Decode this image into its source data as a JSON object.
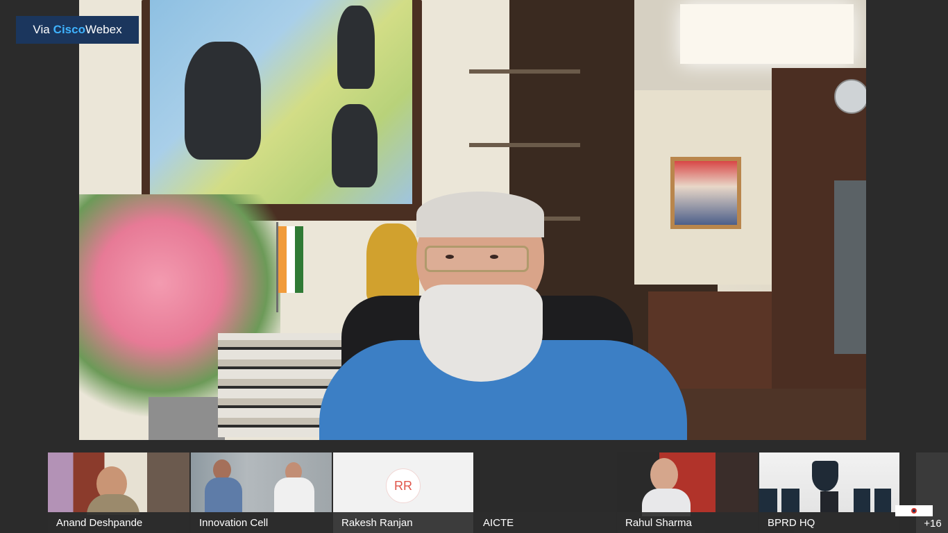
{
  "badge": {
    "via": "Via",
    "brand_a": "Cisco",
    "brand_b": "Webex"
  },
  "main_speaker": {
    "type": "live-video"
  },
  "participants": [
    {
      "name": "Anand Deshpande",
      "video": "on"
    },
    {
      "name": "Innovation Cell",
      "video": "on"
    },
    {
      "name": "Rakesh Ranjan",
      "video": "off",
      "initials": "RR"
    },
    {
      "name": "AICTE",
      "video": "off"
    },
    {
      "name": "Rahul Sharma",
      "video": "on"
    },
    {
      "name": "BPRD HQ",
      "video": "on"
    }
  ],
  "overflow": {
    "label": "+16"
  },
  "colors": {
    "badge_bg": "#1b365d",
    "cisco_blue": "#3fb3ff",
    "strip_bg": "#2b2b2b",
    "initials_red": "#e0554a"
  }
}
